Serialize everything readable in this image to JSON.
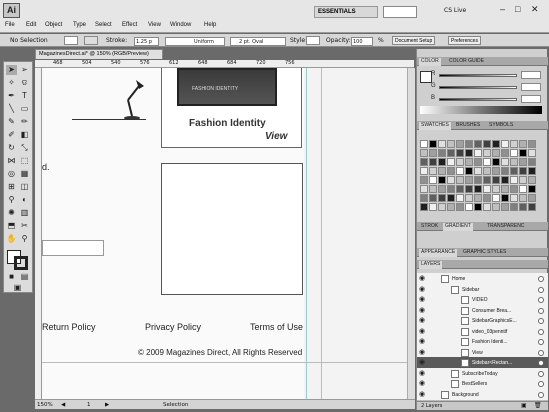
{
  "app": {
    "logo": "Ai",
    "workspace": "ESSENTIALS",
    "cs_live": "CS Live"
  },
  "menu": [
    "File",
    "Edit",
    "Object",
    "Type",
    "Select",
    "Effect",
    "View",
    "Window",
    "Help"
  ],
  "control_bar": {
    "selection": "No Selection",
    "stroke_label": "Stroke:",
    "stroke_value": "1.25 p",
    "uniform": "Uniform",
    "brush": "2 pt. Oval",
    "style_label": "Style:",
    "opacity_label": "Opacity:",
    "opacity_value": "100",
    "percent": "%",
    "doc_setup": "Document Setup",
    "preferences": "Preferences"
  },
  "document": {
    "tab_title": "MagazinesDirect.ai* @ 150% (RGB/Preview)",
    "ruler_ticks": [
      "468",
      "504",
      "540",
      "576",
      "612",
      "648",
      "684",
      "720",
      "756"
    ],
    "video_thumb_label": "FASHION IDENTITY",
    "fashion_title": "Fashion Identity",
    "view_label": "View",
    "fragment_text": "d.",
    "footer_links": [
      "Return Policy",
      "Privacy Policy",
      "Terms of Use"
    ],
    "copyright": "© 2009 Magazines Direct, All Rights Reserved"
  },
  "status_bar": {
    "zoom": "150%",
    "page": "1",
    "tool": "Selection"
  },
  "color_panel": {
    "tabs": [
      "COLOR",
      "COLOR GUIDE"
    ],
    "channels": [
      "R",
      "G",
      "B"
    ]
  },
  "swatches_panel": {
    "tabs": [
      "SWATCHES",
      "BRUSHES",
      "SYMBOLS"
    ]
  },
  "stroke_panel": {
    "tabs": [
      "STROK",
      "GRADIENT",
      "TRANSPARENC"
    ]
  },
  "appearance_panel": {
    "tabs": [
      "APPEARANCE",
      "GRAPHIC STYLES"
    ]
  },
  "layers_panel": {
    "title": "LAYERS",
    "rows": [
      {
        "name": "Home",
        "indent": 0
      },
      {
        "name": "Sidebar",
        "indent": 1
      },
      {
        "name": "VIDEO",
        "indent": 2
      },
      {
        "name": "Consumer Brea...",
        "indent": 2
      },
      {
        "name": "SidebarGraphicsE...",
        "indent": 2
      },
      {
        "name": "video_03penntif",
        "indent": 2
      },
      {
        "name": "Fashion Identi...",
        "indent": 2
      },
      {
        "name": "View",
        "indent": 2
      },
      {
        "name": "Sidebar<Rectan...",
        "indent": 2
      },
      {
        "name": "SubscribeToday",
        "indent": 1
      },
      {
        "name": "BestSellers",
        "indent": 1
      },
      {
        "name": "Background",
        "indent": 0
      }
    ],
    "count": "2 Layers"
  }
}
